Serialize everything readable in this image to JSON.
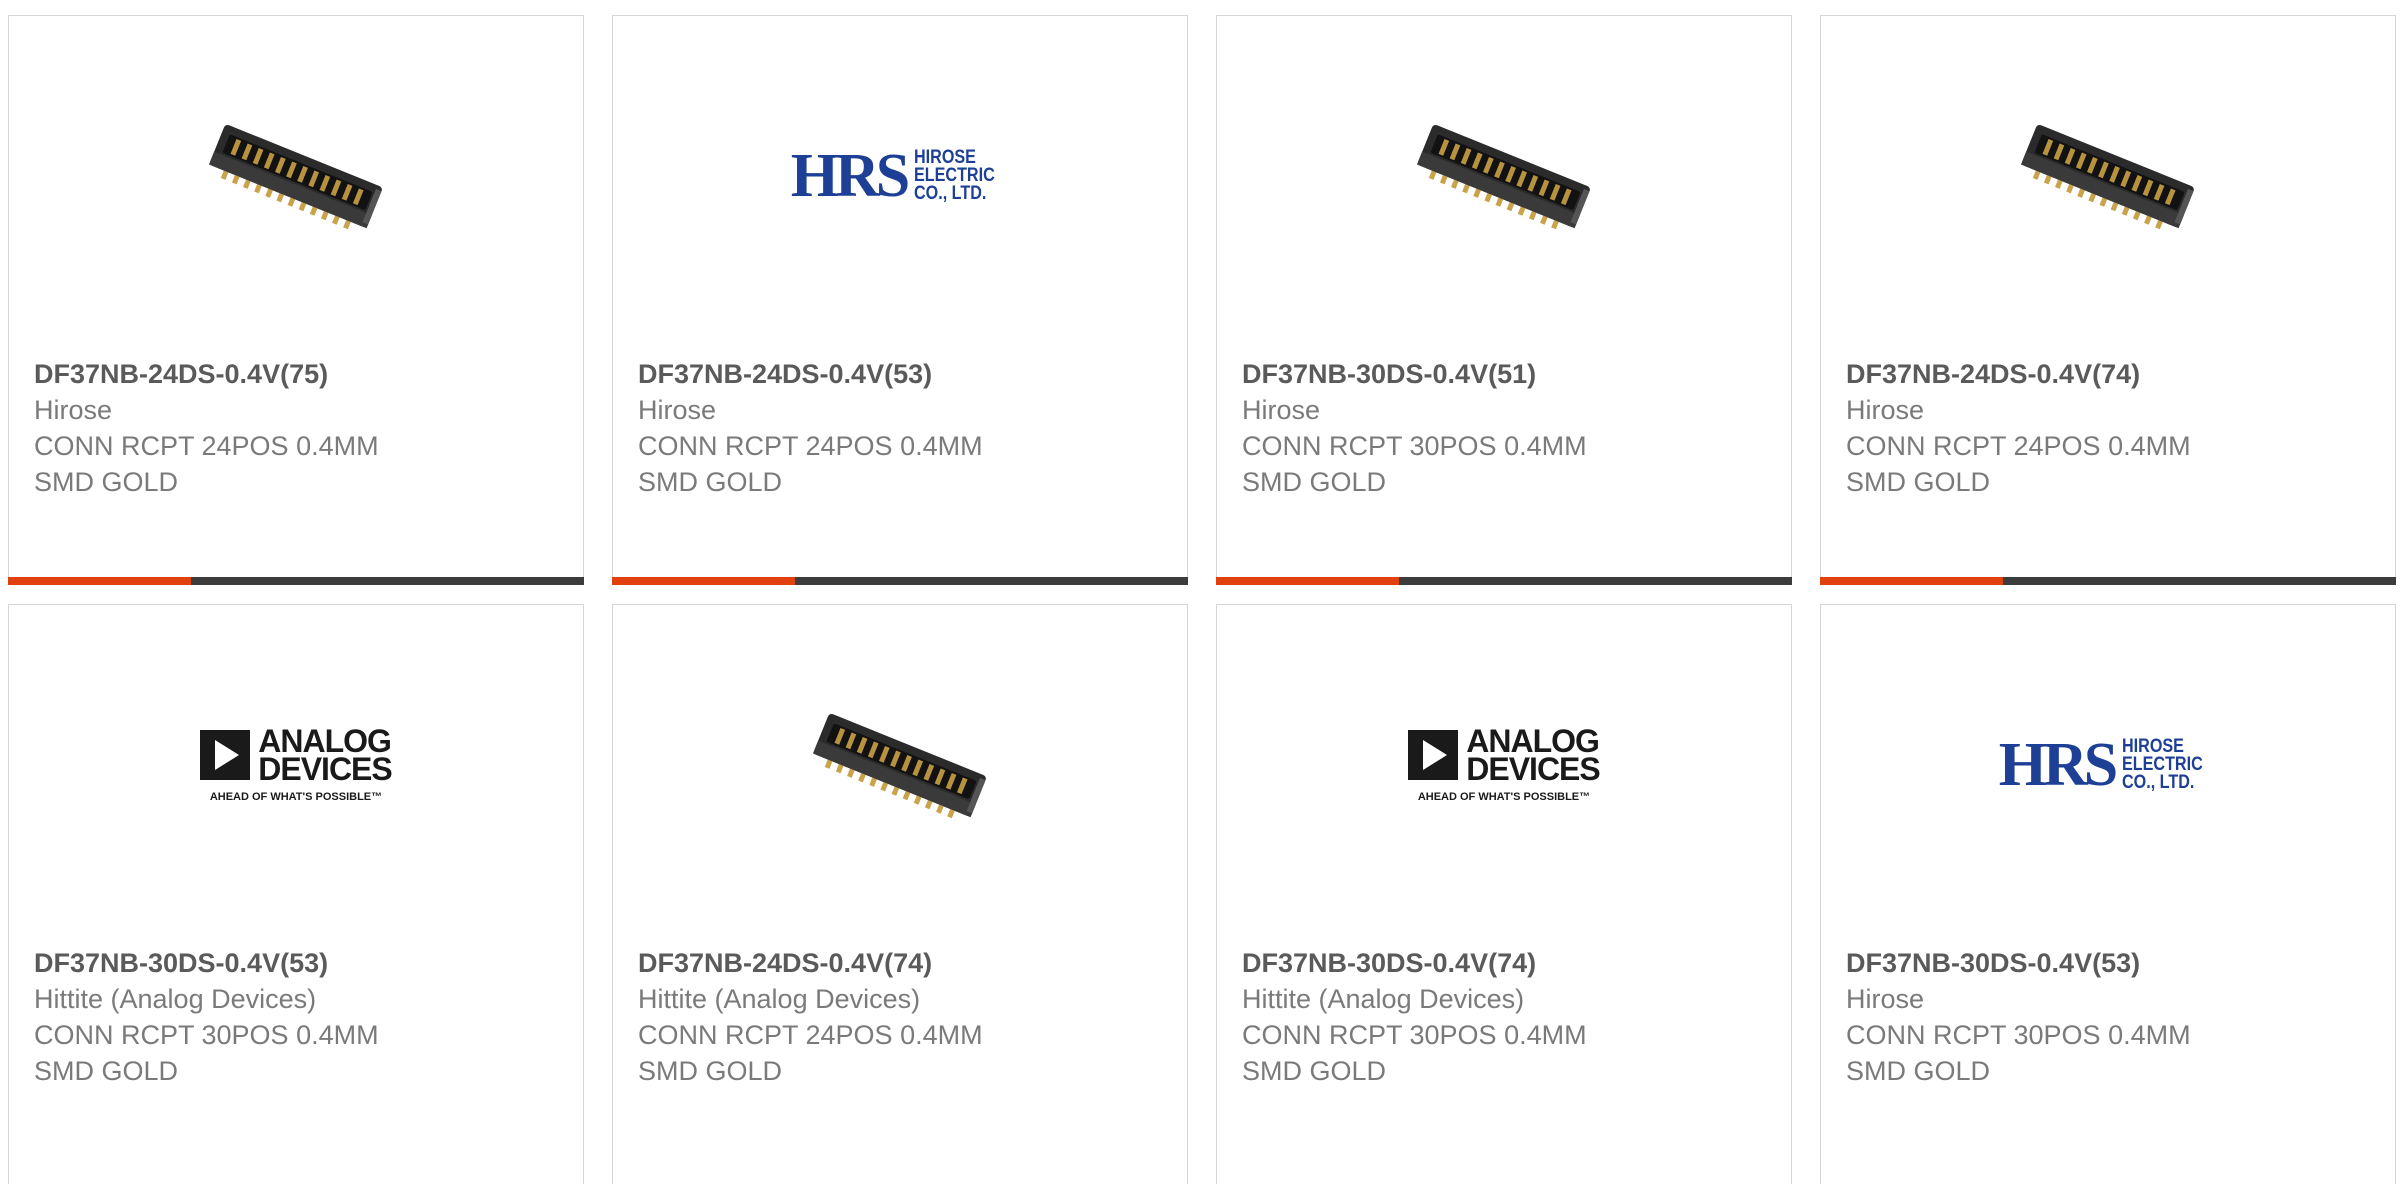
{
  "products": [
    {
      "part": "DF37NB-24DS-0.4V(75)",
      "maker": "Hirose",
      "desc": "CONN RCPT 24POS 0.4MM SMD GOLD",
      "image": "connector-photo"
    },
    {
      "part": "DF37NB-24DS-0.4V(53)",
      "maker": "Hirose",
      "desc": "CONN RCPT 24POS 0.4MM SMD GOLD",
      "image": "hirose-logo"
    },
    {
      "part": "DF37NB-30DS-0.4V(51)",
      "maker": "Hirose",
      "desc": "CONN RCPT 30POS 0.4MM SMD GOLD",
      "image": "connector-photo"
    },
    {
      "part": "DF37NB-24DS-0.4V(74)",
      "maker": "Hirose",
      "desc": "CONN RCPT 24POS 0.4MM SMD GOLD",
      "image": "connector-photo"
    },
    {
      "part": "DF37NB-30DS-0.4V(53)",
      "maker": "Hittite (Analog Devices)",
      "desc": "CONN RCPT 30POS 0.4MM SMD GOLD",
      "image": "analog-devices-logo"
    },
    {
      "part": "DF37NB-24DS-0.4V(74)",
      "maker": "Hittite (Analog Devices)",
      "desc": "CONN RCPT 24POS 0.4MM SMD GOLD",
      "image": "connector-photo"
    },
    {
      "part": "DF37NB-30DS-0.4V(74)",
      "maker": "Hittite (Analog Devices)",
      "desc": "CONN RCPT 30POS 0.4MM SMD GOLD",
      "image": "analog-devices-logo"
    },
    {
      "part": "DF37NB-30DS-0.4V(53)",
      "maker": "Hirose",
      "desc": "CONN RCPT 30POS 0.4MM SMD GOLD",
      "image": "hirose-logo"
    }
  ],
  "logos": {
    "hirose": {
      "mark": "HRS",
      "line1": "HIROSE",
      "line2": "ELECTRIC",
      "line3": "CO., LTD."
    },
    "adi": {
      "line1": "ANALOG",
      "line2": "DEVICES",
      "tagline": "AHEAD OF WHAT'S POSSIBLE™"
    }
  },
  "colors": {
    "accent": "#e1400f",
    "bar": "#3c3c3c",
    "hirose_blue": "#1d3f95"
  }
}
